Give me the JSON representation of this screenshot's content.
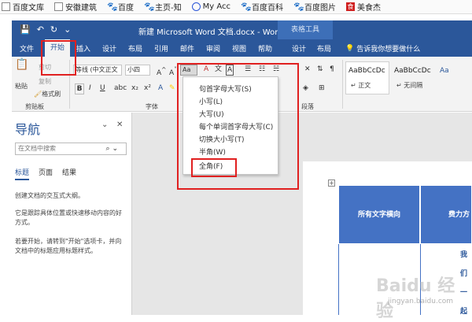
{
  "bookmarks": [
    {
      "label": "百度文库",
      "icon": "file-icon"
    },
    {
      "label": "安徽建筑",
      "icon": "file-icon"
    },
    {
      "label": "百度",
      "icon": "paw-icon"
    },
    {
      "label": "主页-知",
      "icon": "paw-icon"
    },
    {
      "label": "My Acc",
      "icon": "globe-icon"
    },
    {
      "label": "百度百科",
      "icon": "paw-icon"
    },
    {
      "label": "百度图片",
      "icon": "paw-icon"
    },
    {
      "label": "美食杰",
      "icon": "food-icon"
    }
  ],
  "titlebar": {
    "title": "新建 Microsoft Word 文档.docx  -  Word",
    "table_tools": "表格工具"
  },
  "tabs": {
    "file": "文件",
    "home": "开始",
    "insert": "插入",
    "design": "设计",
    "layout": "布局",
    "references": "引用",
    "mailings": "邮件",
    "review": "审阅",
    "view": "视图",
    "help": "帮助",
    "table_design": "设计",
    "table_layout": "布局",
    "tell_me": "告诉我你想要做什么"
  },
  "ribbon": {
    "paste": "粘贴",
    "cut": "剪切",
    "copy": "复制",
    "format_painter": "格式刷",
    "clipboard": "剪贴板",
    "font_name": "等线 (中文正文",
    "font_size": "小四",
    "font_group": "字体",
    "paragraph_group": "段落",
    "change_case_btn": "Aa",
    "styles": [
      {
        "sample": "AaBbCcDc",
        "name": "↵ 正文"
      },
      {
        "sample": "AaBbCcDc",
        "name": "↵ 无间隔"
      }
    ]
  },
  "case_menu": {
    "items": [
      "句首字母大写(S)",
      "小写(L)",
      "大写(U)",
      "每个单词首字母大写(C)",
      "切换大小写(T)",
      "半角(W)",
      "全角(F)"
    ]
  },
  "navigation": {
    "title": "导航",
    "search_placeholder": "在文档中搜索",
    "tabs": [
      "标题",
      "页面",
      "结果"
    ],
    "p1": "创建文档的交互式大纲。",
    "p2": "它是跟踪具体位置或快速移动内容的好方式。",
    "p3": "若要开始，请转到\"开始\"选项卡，并向文档中的标题应用标题样式。"
  },
  "table": {
    "header1": "所有文字横向",
    "header2": "费力方",
    "chars": [
      "我",
      "们",
      "一",
      "起"
    ]
  },
  "watermark": {
    "brand": "Baidu 经验",
    "url": "jingyan.baidu.com"
  },
  "colors": {
    "word_blue": "#2b579a",
    "table_blue": "#4472c4",
    "highlight_red": "#e02020"
  }
}
